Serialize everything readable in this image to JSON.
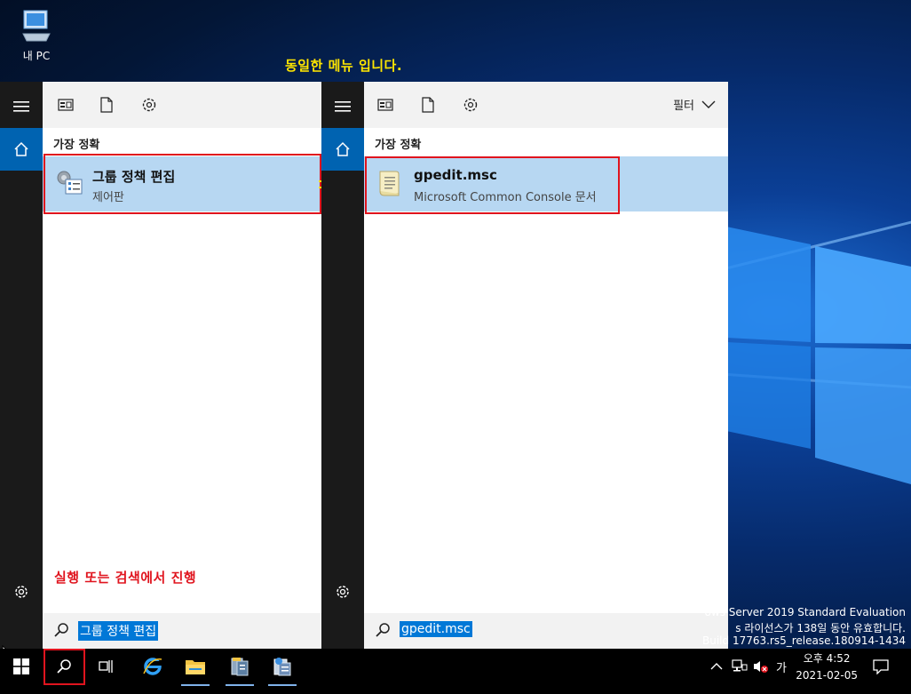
{
  "desktop": {
    "icon_label": "내 PC",
    "annotation_top": "동일한 메뉴 입니다.",
    "annotation_bottom": "실행 또는 검색에서 진행",
    "watermark": [
      "ows Server 2019 Standard Evaluation",
      "s 라이선스가 138일 동안 유효합니다.",
      "Build 17763.rs5_release.180914-1434"
    ]
  },
  "left_panel": {
    "section_label": "가장 정확",
    "result_title": "그룹 정책 편집",
    "result_subtitle": "제어판",
    "search_query": "그룹 정책 편집"
  },
  "right_panel": {
    "filter_label": "필터",
    "section_label": "가장 정확",
    "result_title": "gpedit.msc",
    "result_subtitle": "Microsoft Common Console 문서",
    "search_query": "gpedit.msc"
  },
  "taskbar": {
    "ime_label": "가",
    "time": "오후 4:52",
    "date": "2021-02-05"
  },
  "colors": {
    "accent": "#0078d7",
    "highlight": "#b7d7f2",
    "annotation_yellow": "#ffe600",
    "annotation_red": "#e0141e"
  }
}
